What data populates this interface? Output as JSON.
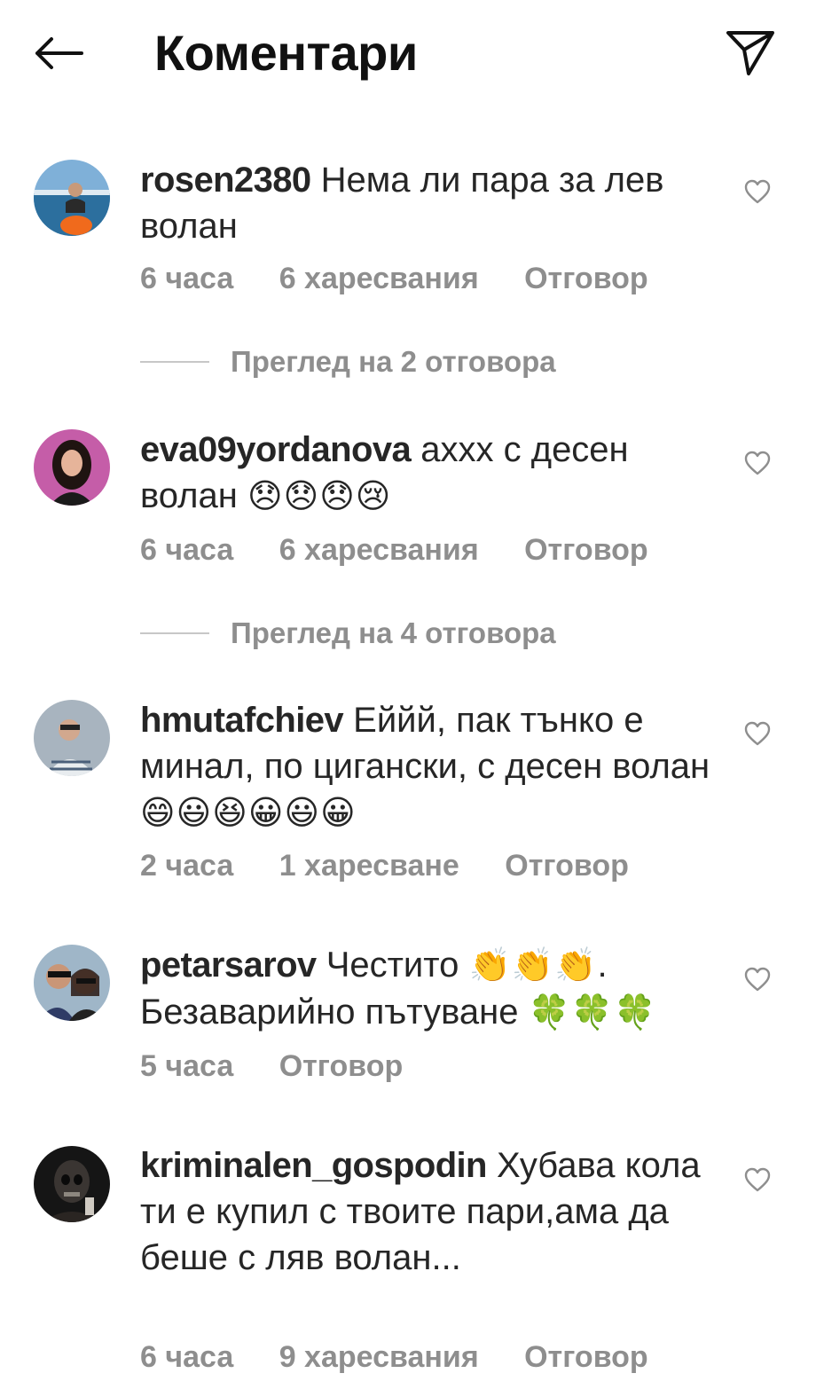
{
  "header": {
    "title": "Коментари",
    "back_icon": "arrow-left-icon",
    "share_icon": "paper-plane-icon"
  },
  "comments": [
    {
      "username": "rosen2380",
      "text": "Нема ли пара за лев волан",
      "emojis": "",
      "time": "6 часа",
      "likes": "6 харесвания",
      "reply": "Отговор",
      "view_replies": "Преглед на 2 отговора"
    },
    {
      "username": "eva09yordanova",
      "text": "ахxx с десен волан",
      "emojis": "😞😞😞😢",
      "time": "6 часа",
      "likes": "6 харесвания",
      "reply": "Отговор",
      "view_replies": "Преглед на 4 отговора"
    },
    {
      "username": "hmutafchiev",
      "text": "Еййй, пак тънко е минал, по цигански, с десен волан",
      "emojis": "😄😃😆😀😃😀",
      "time": "2 часа",
      "likes": "1 харесване",
      "reply": "Отговор"
    },
    {
      "username": "petarsarov",
      "text_a": "Честито",
      "emojis_a": "👏👏👏",
      "text_b": ". Безаварийно пътуване",
      "emojis_b": "🍀🍀🍀",
      "time": "5 часа",
      "reply": "Отговор"
    },
    {
      "username": "kriminalen_gospodin",
      "text": "Хубава кола ти е купил с твоите пари,ама да беше с ляв волан...",
      "time": "6 часа",
      "likes": "9 харесвания",
      "reply": "Отговор"
    }
  ],
  "colors": {
    "text": "#262626",
    "secondary": "#8e8e8e",
    "background": "#ffffff"
  }
}
